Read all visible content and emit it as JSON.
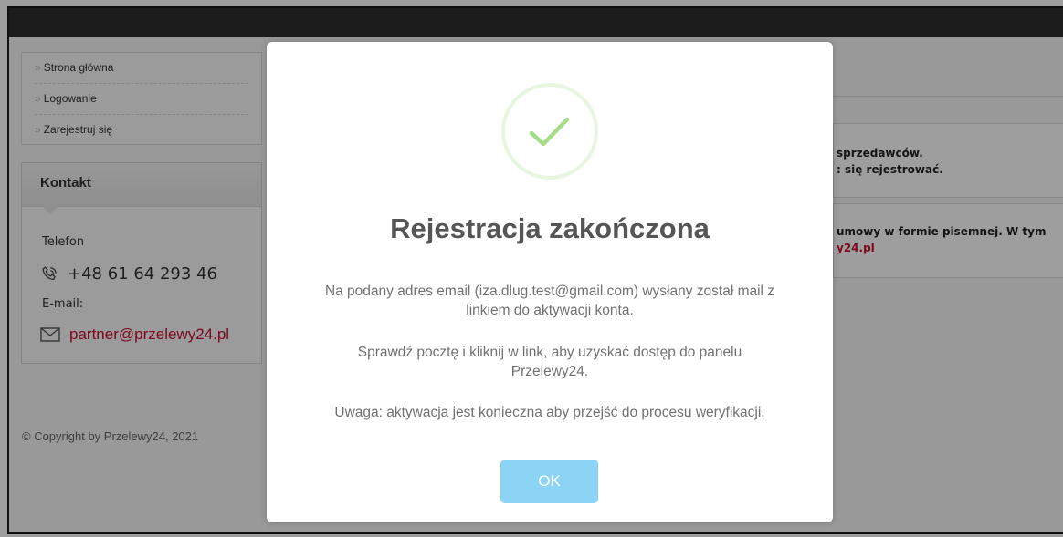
{
  "nav": {
    "items": [
      {
        "label": "Strona główna"
      },
      {
        "label": "Logowanie"
      },
      {
        "label": "Zarejestruj się"
      }
    ],
    "chevron": "»"
  },
  "contact": {
    "title": "Kontakt",
    "phone_label": "Telefon",
    "phone_value": "+48 61 64 293 46",
    "email_label": "E-mail:",
    "email_value": "partner@przelewy24.pl"
  },
  "footer": {
    "copyright": "© Copyright by Przelewy24, 2021"
  },
  "background_text": {
    "line1": "sprzedawców.",
    "line2": ": się rejestrować.",
    "line3": "umowy w formie pisemnej. W tym",
    "line4": "y24.pl"
  },
  "modal": {
    "title": "Rejestracja zakończona",
    "paragraph1": "Na podany adres email (iza.dlug.test@gmail.com) wysłany został mail z linkiem do aktywacji konta.",
    "paragraph2": "Sprawdź pocztę i kliknij w link, aby uzyskać dostęp do panelu Przelewy24.",
    "paragraph3": "Uwaga: aktywacja jest konieczna aby przejść do procesu weryfikacji.",
    "ok_label": "OK",
    "icon": "checkmark-icon"
  },
  "colors": {
    "success": "#a5dc86",
    "button": "#8cd4f5",
    "link": "#c8102e",
    "topbar": "#2d2d2d"
  }
}
